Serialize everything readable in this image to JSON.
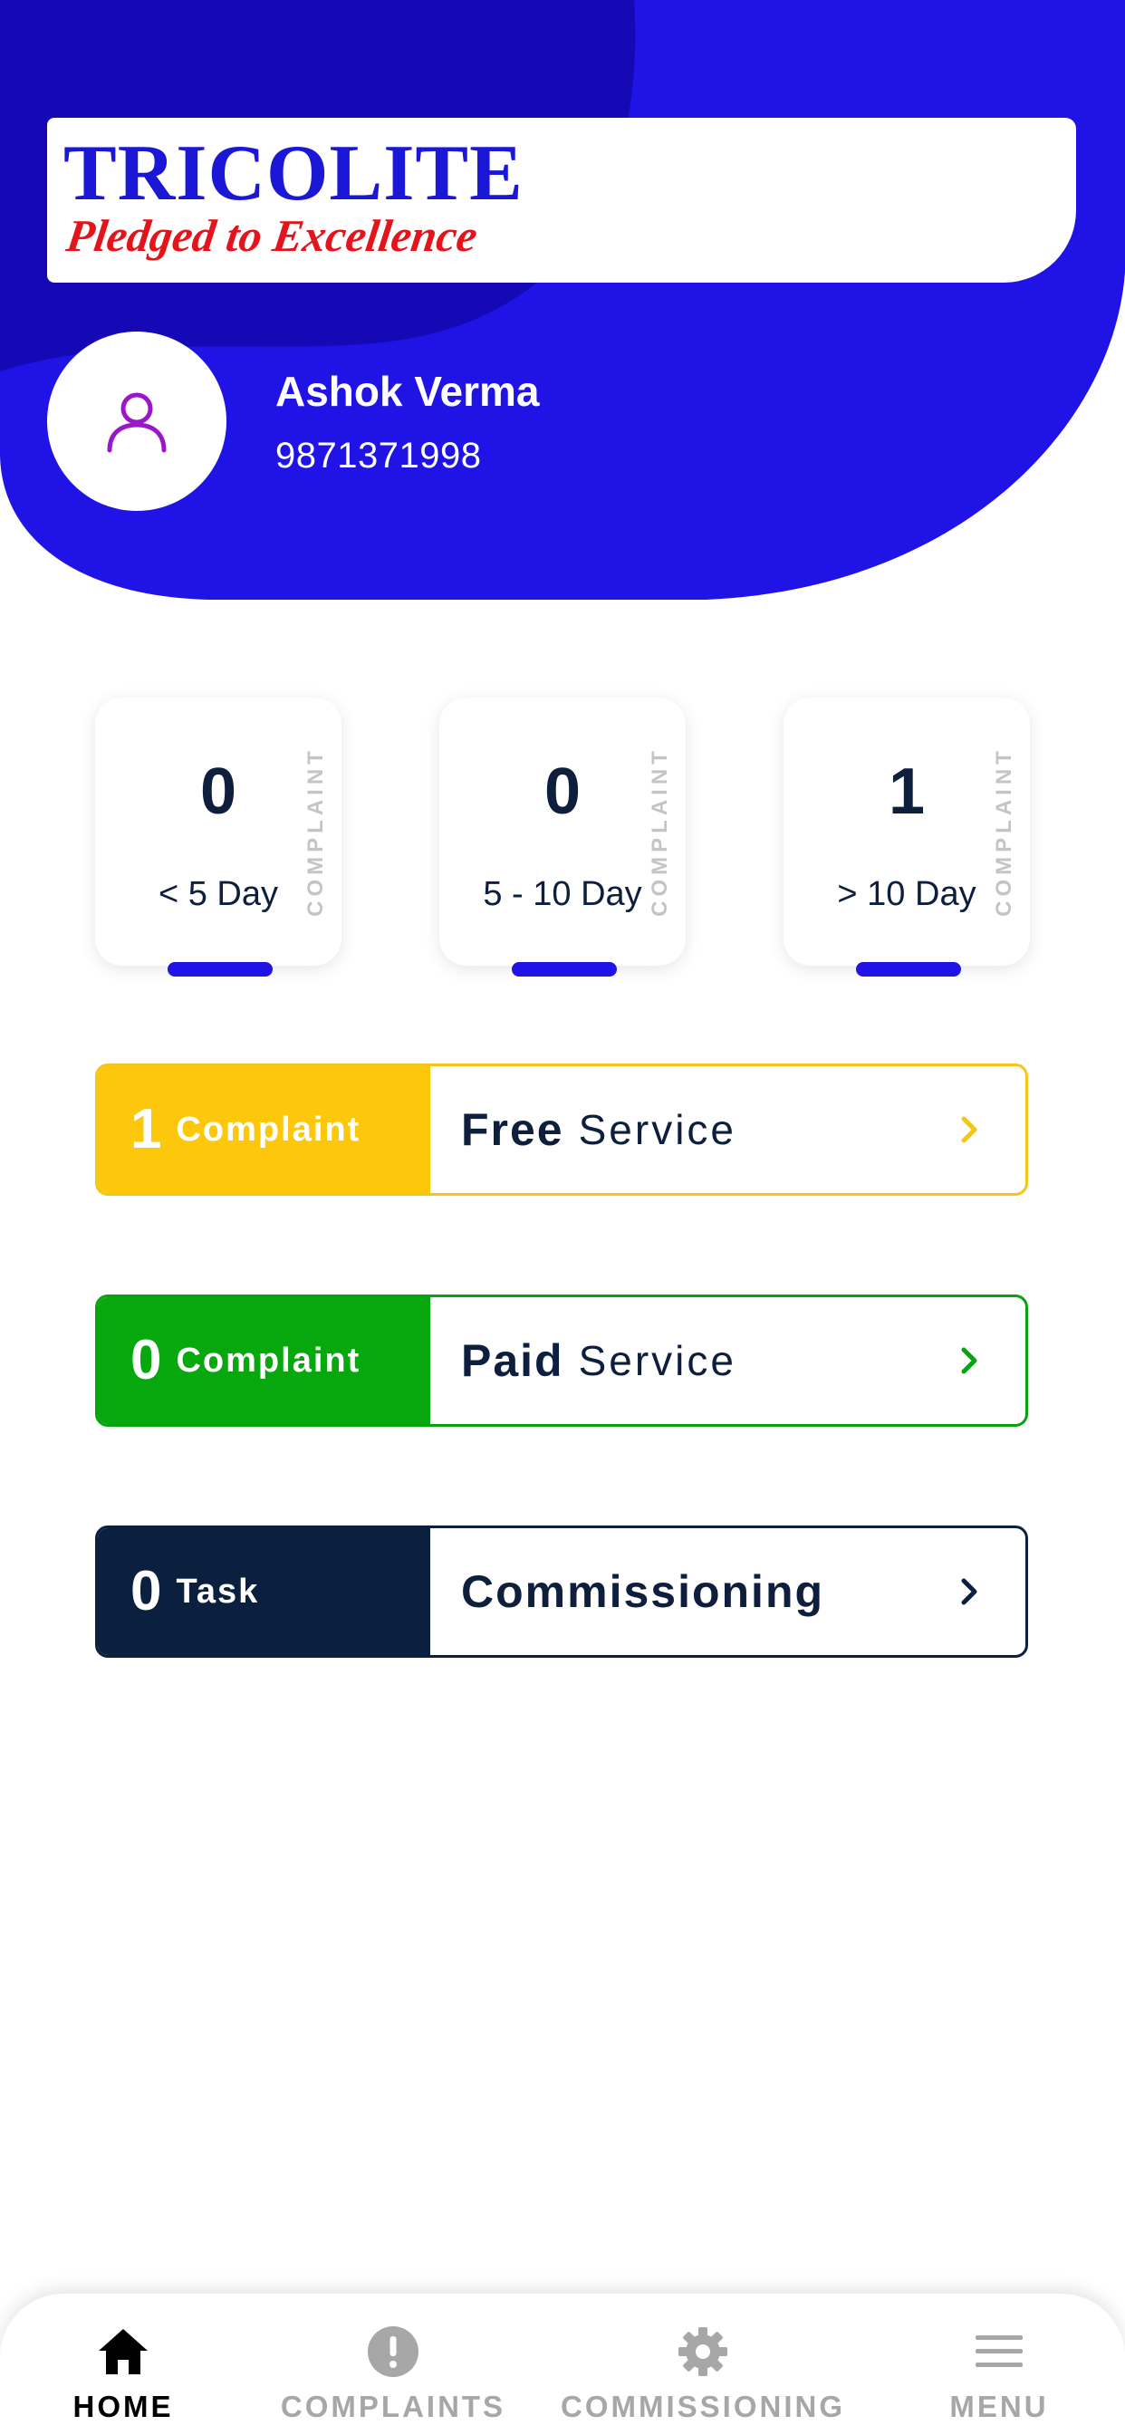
{
  "brand": {
    "name": "TRICOLITE",
    "tagline": "Pledged to Excellence",
    "colors": {
      "header_blue": "#1f13e6",
      "header_dark_blue": "#1409b5",
      "logo_blue": "#1b17d6",
      "logo_red": "#e3141b",
      "avatar_icon": "#9b16c9"
    }
  },
  "user": {
    "name": "Ashok Verma",
    "phone": "9871371998",
    "avatar_icon": "person-outline-icon"
  },
  "stats": [
    {
      "value": "0",
      "range": "< 5 Day",
      "side_label": "COMPLAINT"
    },
    {
      "value": "0",
      "range": "5 - 10 Day",
      "side_label": "COMPLAINT"
    },
    {
      "value": "1",
      "range": "> 10 Day",
      "side_label": "COMPLAINT"
    }
  ],
  "services": {
    "free": {
      "count": "1",
      "unit": "Complaint",
      "strong": "Free",
      "light": "Service",
      "color": "#fdc70c"
    },
    "paid": {
      "count": "0",
      "unit": "Complaint",
      "strong": "Paid",
      "light": "Service",
      "color": "#06a80e"
    },
    "commissioning": {
      "count": "0",
      "unit": "Task",
      "strong": "Commissioning",
      "light": "",
      "color": "#0b1f3e"
    }
  },
  "nav": {
    "active": "home",
    "items": [
      {
        "key": "home",
        "label": "HOME",
        "icon": "home-icon"
      },
      {
        "key": "complaints",
        "label": "COMPLAINTS",
        "icon": "alert-circle-icon"
      },
      {
        "key": "commissioning",
        "label": "COMMISSIONING",
        "icon": "gear-icon"
      },
      {
        "key": "menu",
        "label": "MENU",
        "icon": "hamburger-menu-icon"
      }
    ]
  }
}
